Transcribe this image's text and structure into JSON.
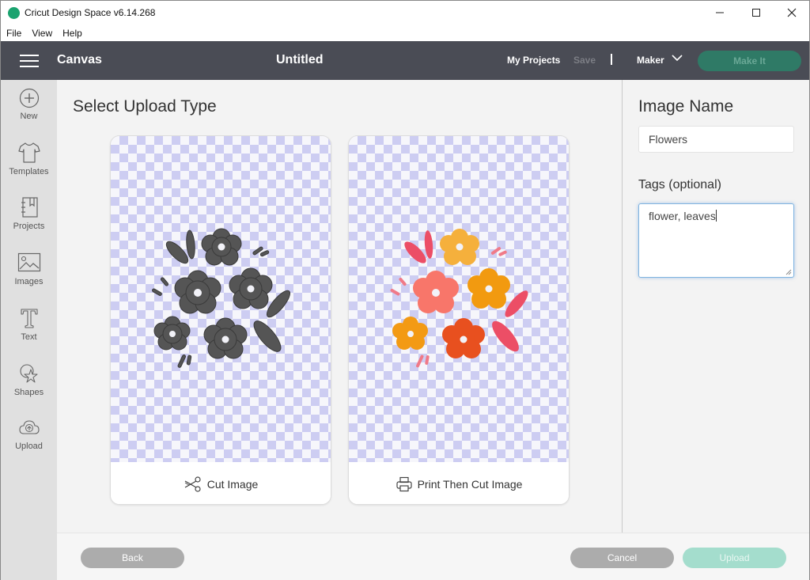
{
  "window": {
    "title": "Cricut Design Space  v6.14.268",
    "controls": {
      "minimize": "—",
      "maximize": "☐",
      "close": "✕"
    },
    "app_icon_color": "#1aa36f"
  },
  "menubar": {
    "items": [
      "File",
      "View",
      "Help"
    ]
  },
  "header": {
    "section": "Canvas",
    "project_title": "Untitled",
    "my_projects": "My Projects",
    "save": "Save",
    "machine": "Maker",
    "make_it": "Make It",
    "make_it_color": "#2f7a66"
  },
  "sidebar": {
    "items": [
      {
        "label": "New",
        "icon": "plus-circle-icon"
      },
      {
        "label": "Templates",
        "icon": "tshirt-icon"
      },
      {
        "label": "Projects",
        "icon": "notebook-icon"
      },
      {
        "label": "Images",
        "icon": "image-icon"
      },
      {
        "label": "Text",
        "icon": "text-t-icon"
      },
      {
        "label": "Shapes",
        "icon": "shapes-icon"
      },
      {
        "label": "Upload",
        "icon": "cloud-upload-icon"
      }
    ]
  },
  "main": {
    "title": "Select Upload Type",
    "options": [
      {
        "label": "Cut Image",
        "icon": "scissors-icon",
        "preview": "dark gray flower silhouettes"
      },
      {
        "label": "Print Then Cut Image",
        "icon": "printer-icon",
        "preview": "colored flowers and leaves"
      }
    ]
  },
  "right_panel": {
    "image_name_label": "Image Name",
    "image_name_value": "Flowers",
    "tags_label": "Tags (optional)",
    "tags_value": "flower, leaves"
  },
  "footer": {
    "back": "Back",
    "cancel": "Cancel",
    "upload": "Upload",
    "upload_color": "#a4ddcd"
  }
}
